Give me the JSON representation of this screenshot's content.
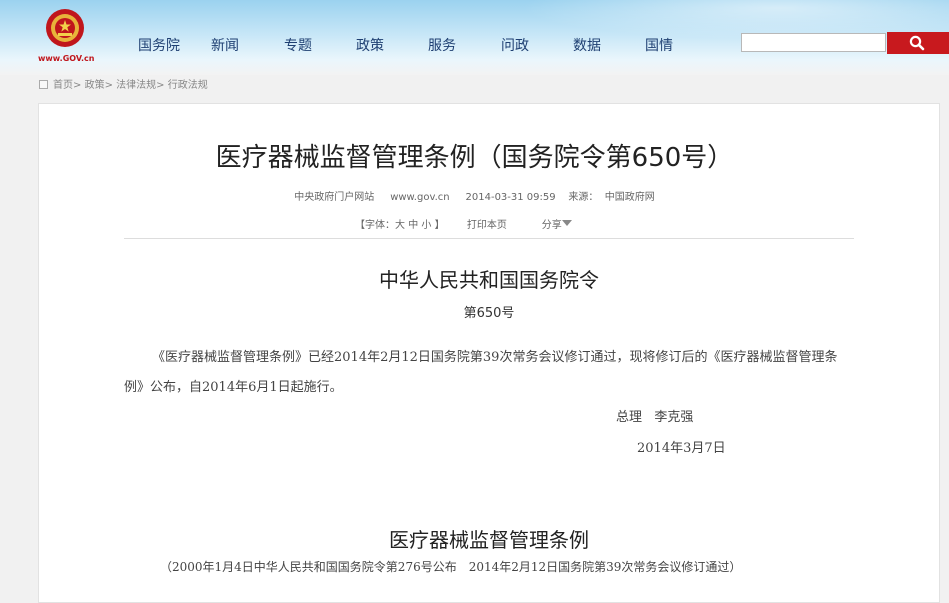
{
  "header": {
    "logo_text": "www.GOV.cn",
    "nav": [
      "国务院",
      "新闻",
      "专题",
      "政策",
      "服务",
      "问政",
      "数据",
      "国情"
    ],
    "search": {
      "placeholder": ""
    },
    "colors": {
      "nav": "#1e3f72",
      "search_button": "#c8191e",
      "emblem": "#c0161c"
    }
  },
  "breadcrumb": {
    "items": [
      "首页",
      "政策",
      "法律法规",
      "行政法规"
    ],
    "separator": ">"
  },
  "article": {
    "title": "医疗器械监督管理条例（国务院令第650号）",
    "source_site": "中央政府门户网站",
    "url": "www.gov.cn",
    "datetime": "2014-03-31 09:59",
    "source_label": "来源：",
    "source": "中国政府网",
    "font_label": "【字体：",
    "font_large": "大",
    "font_medium": "中",
    "font_small": "小",
    "font_close": "】",
    "print": "打印本页",
    "share": "分享"
  },
  "decree": {
    "title": "中华人民共和国国务院令",
    "number": "第650号",
    "body": "《医疗器械监督管理条例》已经2014年2月12日国务院第39次常务会议修订通过，现将修订后的《医疗器械监督管理条例》公布，自2014年6月1日起施行。",
    "signer_title": "总理",
    "signer": "李克强",
    "date": "2014年3月7日"
  },
  "regulation": {
    "title": "医疗器械监督管理条例",
    "note": "（2000年1月4日中华人民共和国国务院令第276号公布　2014年2月12日国务院第39次常务会议修订通过）"
  }
}
